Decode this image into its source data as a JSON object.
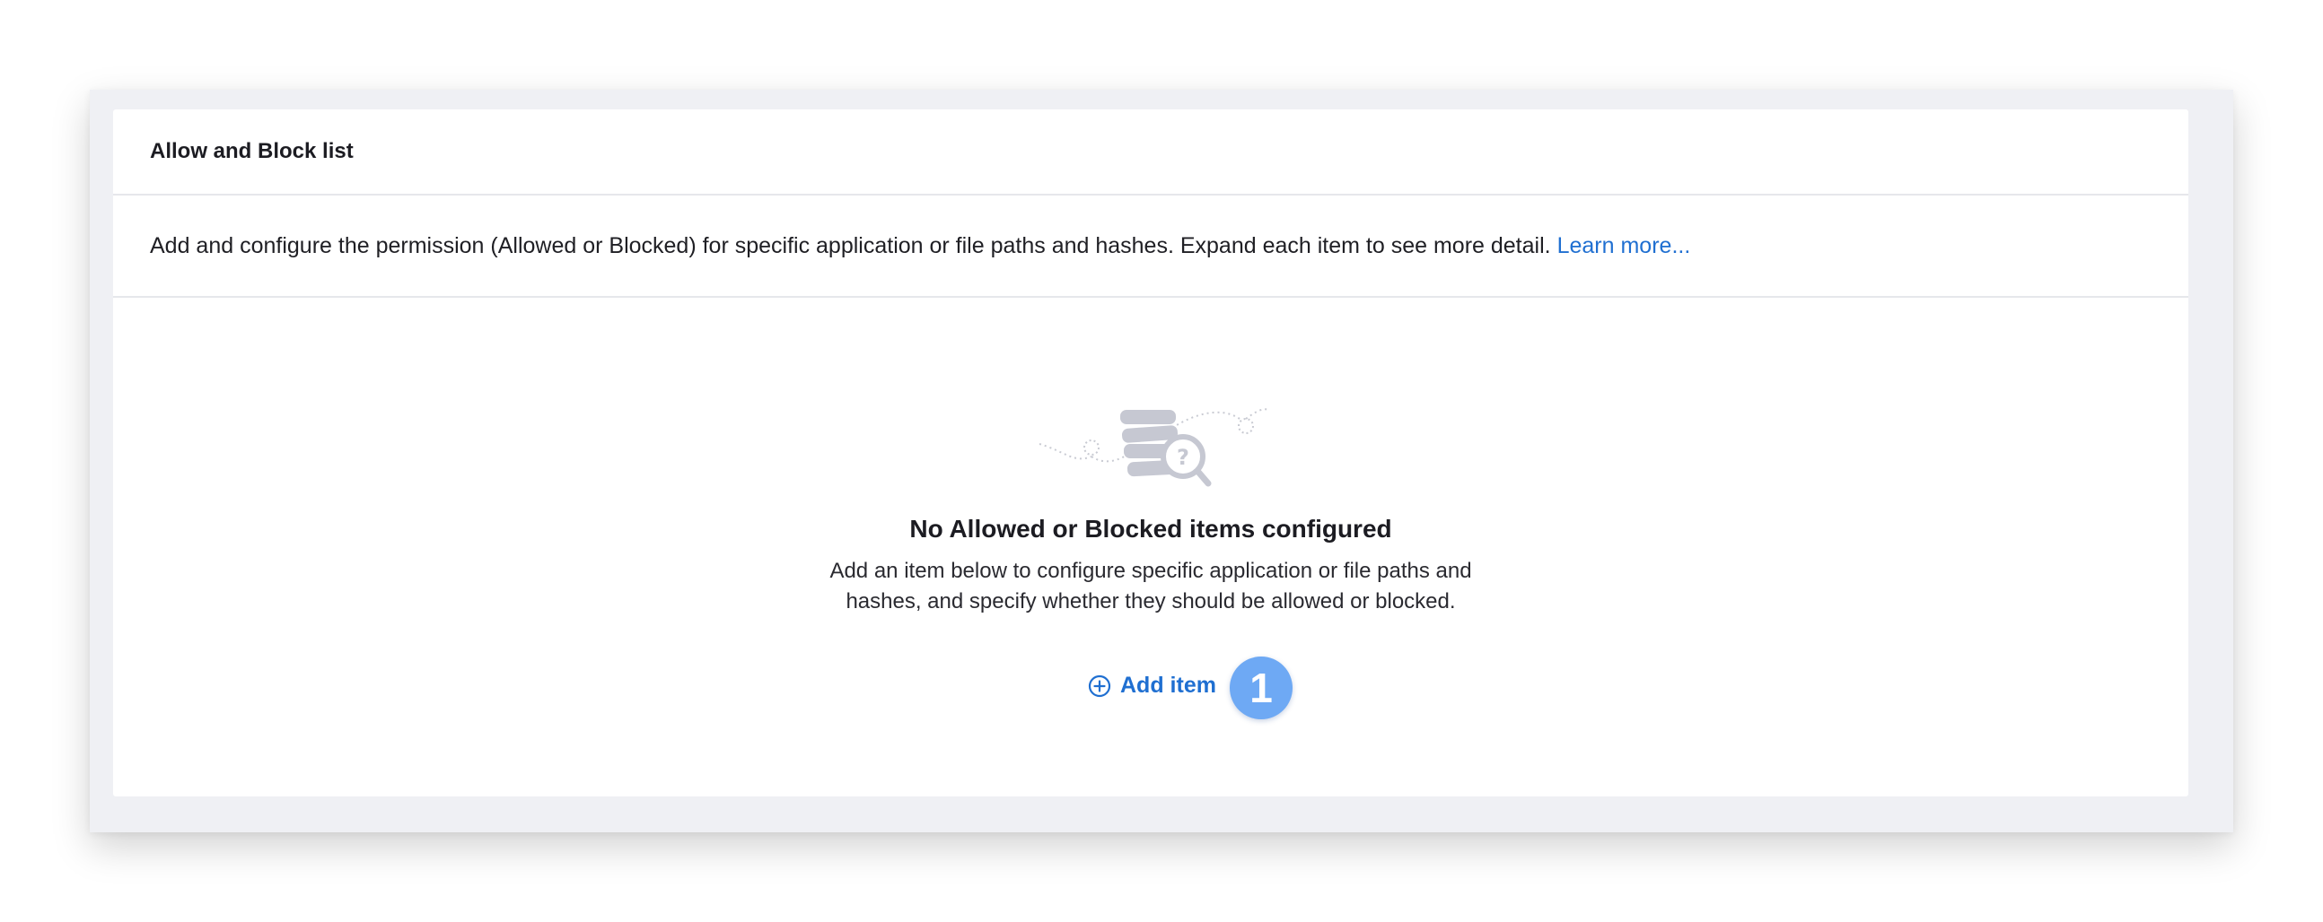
{
  "panel": {
    "title": "Allow and Block list",
    "description": "Add and configure the permission (Allowed or Blocked) for specific application or file paths and hashes. Expand each item to see more detail.",
    "learn_more": "Learn more..."
  },
  "empty_state": {
    "illustration": "database-search-icon",
    "title": "No Allowed or Blocked items configured",
    "body_line1": "Add an item below to configure specific application or file paths and",
    "body_line2": "hashes, and specify whether they should be allowed or blocked.",
    "add_label": "Add item",
    "add_icon": "plus-circle-icon"
  },
  "callout": {
    "number": "1",
    "color": "#6ea9f4"
  },
  "colors": {
    "accent": "#1f6fd1",
    "frame": "#eff0f4",
    "divider": "#e6e7eb"
  }
}
